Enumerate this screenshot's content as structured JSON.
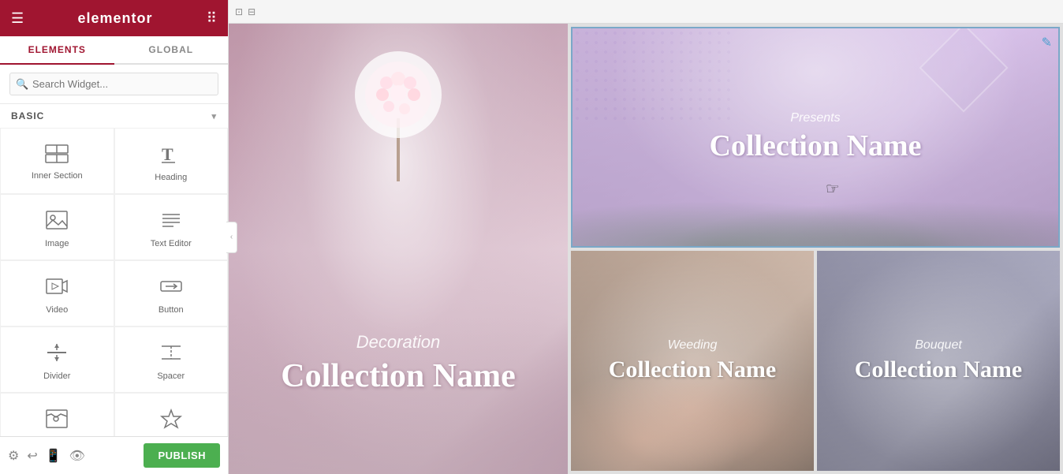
{
  "app": {
    "title": "elementor",
    "hamburger_icon": "☰",
    "grid_icon": "⠿"
  },
  "left_panel": {
    "tabs": [
      {
        "id": "elements",
        "label": "ELEMENTS",
        "active": true
      },
      {
        "id": "global",
        "label": "GLOBAL",
        "active": false
      }
    ],
    "search": {
      "placeholder": "Search Widget..."
    },
    "section_label": "BASIC",
    "widgets": [
      {
        "id": "inner-section",
        "label": "Inner Section",
        "icon": "inner_section"
      },
      {
        "id": "heading",
        "label": "Heading",
        "icon": "heading"
      },
      {
        "id": "image",
        "label": "Image",
        "icon": "image"
      },
      {
        "id": "text-editor",
        "label": "Text Editor",
        "icon": "text_editor"
      },
      {
        "id": "video",
        "label": "Video",
        "icon": "video"
      },
      {
        "id": "button",
        "label": "Button",
        "icon": "button"
      },
      {
        "id": "divider",
        "label": "Divider",
        "icon": "divider"
      },
      {
        "id": "spacer",
        "label": "Spacer",
        "icon": "spacer"
      },
      {
        "id": "widget-9",
        "label": "",
        "icon": "map"
      },
      {
        "id": "widget-10",
        "label": "",
        "icon": "star"
      }
    ],
    "bottom": {
      "publish_label": "PUBLISH"
    }
  },
  "canvas": {
    "topbar_icons": [
      "⊡",
      "⊟"
    ],
    "left_section": {
      "subtitle": "Decoration",
      "title": "Collection Name"
    },
    "right_top": {
      "subtitle": "Presents",
      "title": "Collection Name"
    },
    "right_bottom": [
      {
        "id": "weeding",
        "subtitle": "Weeding",
        "title": "Collection Name"
      },
      {
        "id": "bouquet",
        "subtitle": "Bouquet",
        "title": "Collection Name"
      }
    ]
  },
  "top_right_icon": "✎"
}
